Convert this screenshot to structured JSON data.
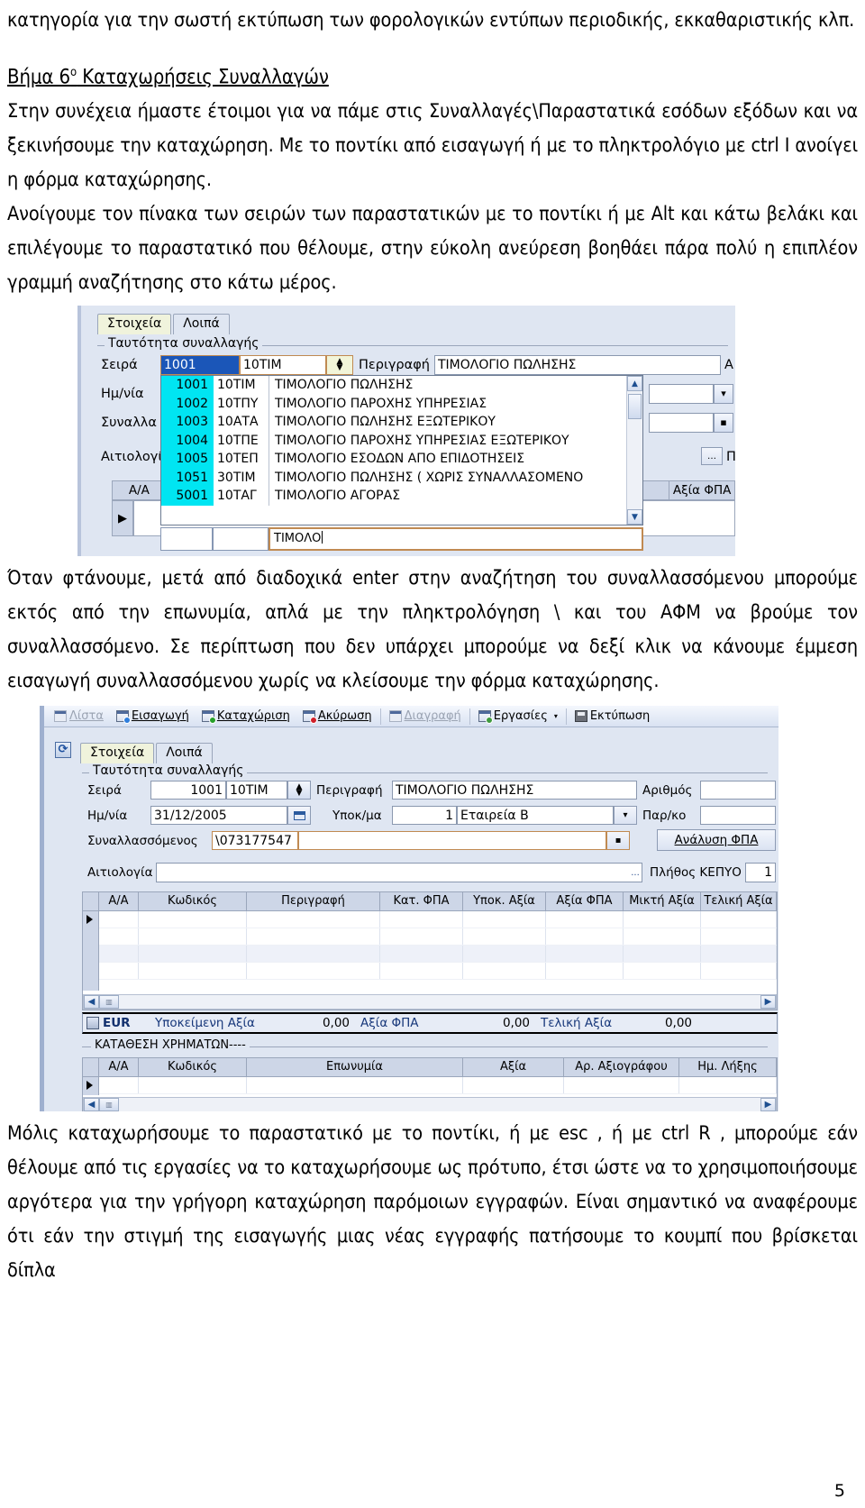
{
  "document": {
    "paragraphs": [
      "κατηγορία για την σωστή εκτύπωση των φορολογικών εντύπων περιοδικής, εκκαθαριστικής κλπ.",
      "Στην συνέχεια ήμαστε έτοιμοι για να πάμε στις Συναλλαγές\\Παραστατικά εσόδων εξόδων και να ξεκινήσουμε την καταχώρηση. Με το ποντίκι από εισαγωγή ή με το πληκτρολόγιο με ctrl I ανοίγει η φόρμα καταχώρησης.",
      "Ανοίγουμε τον πίνακα των σειρών των παραστατικών με το ποντίκι ή με Alt και κάτω βελάκι και επιλέγουμε το παραστατικό που θέλουμε, στην εύκολη ανεύρεση  βοηθάει πάρα πολύ η επιπλέον γραμμή αναζήτησης στο κάτω μέρος.",
      "Όταν φτάνουμε, μετά από διαδοχικά enter στην αναζήτηση του συναλλασσόμενου μπορούμε εκτός από την επωνυμία, απλά με την πληκτρολόγηση \\ και του ΑΦΜ να βρούμε τον συναλλασσόμενο. Σε περίπτωση που δεν υπάρχει μπορούμε να δεξί κλικ να κάνουμε έμμεση εισαγωγή συναλλασσόμενου χωρίς να κλείσουμε την φόρμα καταχώρησης.",
      "Μόλις καταχωρήσουμε το παραστατικό με το ποντίκι, ή με esc , ή με ctrl R , μπορούμε εάν θέλουμε από τις εργασίες να το καταχωρήσουμε ως πρότυπο, έτσι ώστε να το χρησιμοποιήσουμε αργότερα για την γρήγορη καταχώρηση παρόμοιων εγγραφών. Είναι σημαντικό να αναφέρουμε ότι εάν την στιγμή της εισαγωγής μιας νέας εγγραφής πατήσουμε το κουμπί που βρίσκεται δίπλα"
    ],
    "heading": {
      "prefix": "Βήμα 6",
      "sup": "ο",
      "text": " Καταχωρήσεις Συναλλαγών"
    },
    "page_number": "5"
  },
  "screenshot1": {
    "tabs": [
      {
        "label": "Στοιχεία",
        "active": true
      },
      {
        "label": "Λοιπά",
        "active": false
      }
    ],
    "groupbox_label": "Ταυτότητα συναλλαγής",
    "labels": {
      "seira": "Σειρά",
      "hmnia": "Ημ/νία",
      "synall": "Συναλλα",
      "aitiologia": "Αιτιολογί",
      "perigrafi": "Περιγραφή",
      "a_right": "Α",
      "pi_right": "Π",
      "axia_fpa": "Αξία ΦΠΑ",
      "aa": "Α/Α"
    },
    "fields": {
      "seira_code": "1001",
      "seira_abbr": "10ΤΙΜ",
      "perigrafi_value": "ΤΙΜΟΛΟΓΙΟ ΠΩΛΗΣΗΣ"
    },
    "dropdown_rows": [
      {
        "code": "1001",
        "abbr": "10ΤΙΜ",
        "desc": "ΤΙΜΟΛΟΓΙΟ ΠΩΛΗΣΗΣ"
      },
      {
        "code": "1002",
        "abbr": "10ΤΠΥ",
        "desc": "ΤΙΜΟΛΟΓΙΟ ΠΑΡΟΧΗΣ ΥΠΗΡΕΣΙΑΣ"
      },
      {
        "code": "1003",
        "abbr": "10ΑΤΑ",
        "desc": "ΤΙΜΟΛΟΓΙΟ ΠΩΛΗΣΗΣ ΕΞΩΤΕΡΙΚΟΥ"
      },
      {
        "code": "1004",
        "abbr": "10ΤΠΕ",
        "desc": "ΤΙΜΟΛΟΓΙΟ ΠΑΡΟΧΗΣ ΥΠΗΡΕΣΙΑΣ ΕΞΩΤΕΡΙΚΟΥ"
      },
      {
        "code": "1005",
        "abbr": "10ΤΕΠ",
        "desc": "ΤΙΜΟΛΟΓΙΟ ΕΣΟΔΩΝ ΑΠΟ ΕΠΙΔΟΤΗΣΕΙΣ"
      },
      {
        "code": "1051",
        "abbr": "30ΤΙΜ",
        "desc": "ΤΙΜΟΛΟΓΙΟ ΠΩΛΗΣΗΣ ( ΧΩΡΙΣ ΣΥΝΑΛΛΑΣΟΜΕΝΟ"
      },
      {
        "code": "5001",
        "abbr": "10ΤΑΓ",
        "desc": "ΤΙΜΟΛΟΓΙΟ ΑΓΟΡΑΣ"
      }
    ],
    "search_value": "ΤΙΜΟΛΟ"
  },
  "screenshot2": {
    "toolbar": [
      {
        "label": "Λίστα",
        "accel": "Λ",
        "disabled": true,
        "icon": "list-icon",
        "badge": ""
      },
      {
        "label": "Εισαγωγή",
        "accel": "Ε",
        "disabled": false,
        "icon": "insert-icon",
        "badge": "blue"
      },
      {
        "label": "Καταχώριση",
        "accel": "Κ",
        "disabled": false,
        "icon": "save-icon",
        "badge": "green"
      },
      {
        "label": "Ακύρωση",
        "accel": "Α",
        "disabled": false,
        "icon": "cancel-icon",
        "badge": "red"
      },
      {
        "label": "Διαγραφή",
        "accel": "Δ",
        "disabled": true,
        "icon": "delete-icon",
        "badge": ""
      },
      {
        "label": "Εργασίες",
        "accel": "",
        "disabled": false,
        "icon": "tasks-icon",
        "badge": "greenflag",
        "caret": "▾"
      },
      {
        "label": "Εκτύπωση",
        "accel": "",
        "disabled": false,
        "icon": "printer-icon",
        "badge": ""
      }
    ],
    "tabs": [
      {
        "label": "Στοιχεία",
        "active": true
      },
      {
        "label": "Λοιπά",
        "active": false
      }
    ],
    "groupbox_label": "Ταυτότητα συναλλαγής",
    "form": {
      "seira_label": "Σειρά",
      "seira_code": "1001",
      "seira_abbr": "10ΤΙΜ",
      "perigrafi_label": "Περιγραφή",
      "perigrafi_value": "ΤΙΜΟΛΟΓΙΟ ΠΩΛΗΣΗΣ",
      "arithmos_label": "Αριθμός",
      "arithmos_value": "",
      "hmnia_label": "Ημ/νία",
      "hmnia_value": "31/12/2005",
      "ypokma_label": "Υποκ/μα",
      "ypokma_code": "1",
      "ypokma_name": "Εταιρεία Β",
      "parko_label": "Παρ/κο",
      "parko_value": "",
      "synallassomenos_label": "Συναλλασσόμενος",
      "synallassomenos_value": "\\073177547",
      "synallassomenos_name": "",
      "analysi_fpa_label": "Ανάλυση ΦΠΑ",
      "analysi_fpa_accel": "Α",
      "aitiologia_label": "Αιτιολογία",
      "aitiologia_value": "",
      "ellipsis_btn": "...",
      "plithos_kepyo_label": "Πλήθος ΚΕΠΥΟ",
      "plithos_kepyo_value": "1"
    },
    "grid_main_headers": [
      "Α/Α",
      "Κωδικός",
      "Περιγραφή",
      "Κατ. ΦΠΑ",
      "Υποκ. Αξία",
      "Αξία ΦΠΑ",
      "Μικτή Αξία",
      "Τελική Αξία"
    ],
    "totals": {
      "currency": "EUR",
      "items": [
        {
          "label": "Υποκείμενη Αξία",
          "value": "0,00"
        },
        {
          "label": "Αξία ΦΠΑ",
          "value": "0,00"
        },
        {
          "label": "Τελική Αξία",
          "value": "0,00"
        }
      ]
    },
    "group2_label": "ΚΑΤΑΘΕΣΗ ΧΡΗΜΑΤΩΝ----",
    "grid_bottom_headers": [
      "Α/Α",
      "Κωδικός",
      "Επωνυμία",
      "Αξία",
      "Αρ. Αξιογράφου",
      "Ημ. Λήξης"
    ]
  }
}
